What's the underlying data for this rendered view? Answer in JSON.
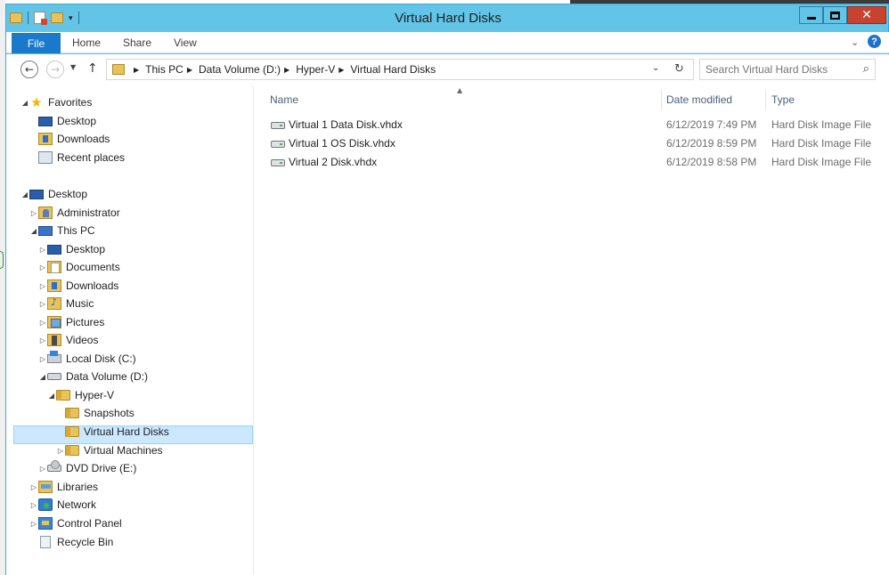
{
  "window": {
    "title": "Virtual Hard Disks"
  },
  "title_controls": {
    "minimize": "minimize",
    "maximize": "maximize",
    "close": "✕"
  },
  "ribbon": {
    "file": "File",
    "home": "Home",
    "share": "Share",
    "view": "View"
  },
  "address": {
    "crumbs": [
      "This PC",
      "Data Volume (D:)",
      "Hyper-V",
      "Virtual Hard Disks"
    ]
  },
  "search": {
    "placeholder": "Search Virtual Hard Disks"
  },
  "columns": {
    "name": "Name",
    "date": "Date modified",
    "type": "Type"
  },
  "files": [
    {
      "name": "Virtual 1 Data Disk.vhdx",
      "date": "6/12/2019 7:49 PM",
      "type": "Hard Disk Image File"
    },
    {
      "name": "Virtual 1 OS Disk.vhdx",
      "date": "6/12/2019 8:59 PM",
      "type": "Hard Disk Image File"
    },
    {
      "name": "Virtual 2 Disk.vhdx",
      "date": "6/12/2019 8:58 PM",
      "type": "Hard Disk Image File"
    }
  ],
  "tree": {
    "favorites": "Favorites",
    "fav_desktop": "Desktop",
    "fav_downloads": "Downloads",
    "fav_recent": "Recent places",
    "desktop": "Desktop",
    "administrator": "Administrator",
    "this_pc": "This PC",
    "pc_desktop": "Desktop",
    "documents": "Documents",
    "downloads": "Downloads",
    "music": "Music",
    "pictures": "Pictures",
    "videos": "Videos",
    "local_disk": "Local Disk (C:)",
    "data_volume": "Data Volume (D:)",
    "hyperv": "Hyper-V",
    "snapshots": "Snapshots",
    "virtual_hard_disks": "Virtual Hard Disks",
    "virtual_machines": "Virtual Machines",
    "dvd_drive": "DVD Drive (E:)",
    "libraries": "Libraries",
    "network": "Network",
    "control_panel": "Control Panel",
    "recycle_bin": "Recycle Bin"
  },
  "colors": {
    "titlebar": "#62c5e8",
    "file_tab": "#1979ca",
    "selection": "#cce8ff",
    "close_button": "#c7432f"
  }
}
